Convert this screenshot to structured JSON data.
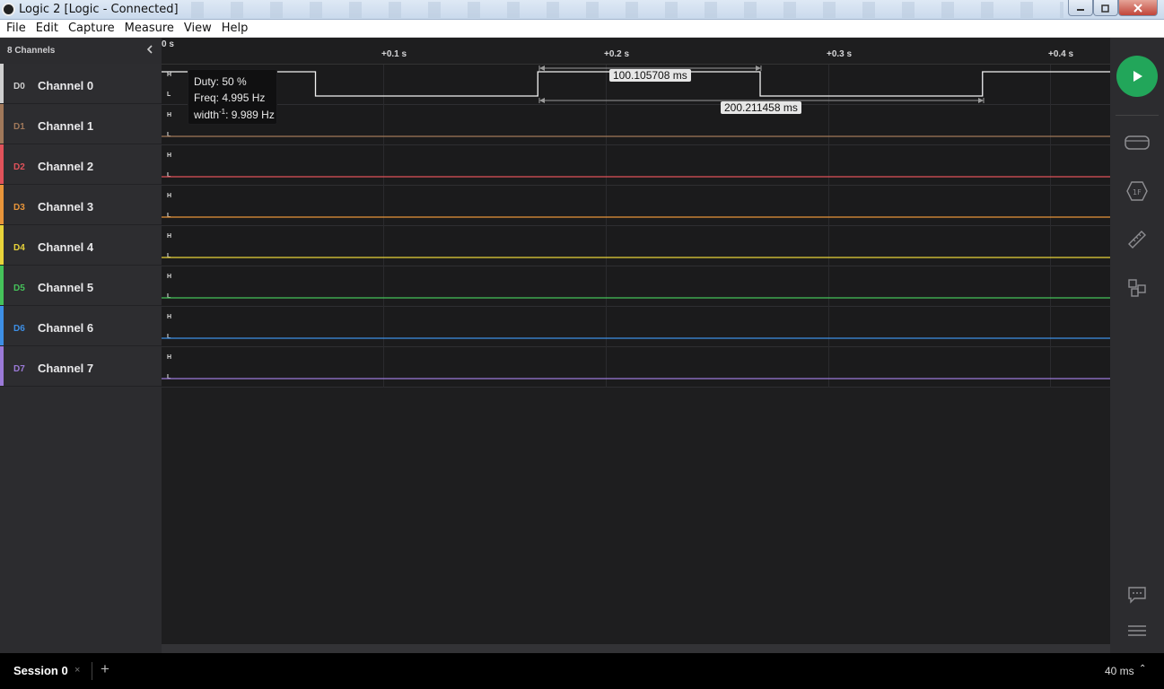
{
  "window": {
    "title": "Logic 2 [Logic - Connected]"
  },
  "menu": [
    "File",
    "Edit",
    "Capture",
    "Measure",
    "View",
    "Help"
  ],
  "sidebar": {
    "header": "8 Channels",
    "channels": [
      {
        "id": "D0",
        "name": "Channel 0",
        "color": "#cfcfcf"
      },
      {
        "id": "D1",
        "name": "Channel 1",
        "color": "#a0785a"
      },
      {
        "id": "D2",
        "name": "Channel 2",
        "color": "#e0525a"
      },
      {
        "id": "D3",
        "name": "Channel 3",
        "color": "#e8953a"
      },
      {
        "id": "D4",
        "name": "Channel 4",
        "color": "#e8d33a"
      },
      {
        "id": "D5",
        "name": "Channel 5",
        "color": "#45c25a"
      },
      {
        "id": "D6",
        "name": "Channel 6",
        "color": "#3d8fe6"
      },
      {
        "id": "D7",
        "name": "Channel 7",
        "color": "#9b7ad8"
      }
    ]
  },
  "ruler": {
    "ticks": [
      "0 s",
      "+0.1 s",
      "+0.2 s",
      "+0.3 s",
      "+0.4 s"
    ]
  },
  "lane_levels": {
    "high": "H",
    "low": "L"
  },
  "tooltip": {
    "duty": "Duty: 50 %",
    "freq": "Freq: 4.995 Hz",
    "width_prefix": "width",
    "width_sup": "-1",
    "width_value": ": 9.989 Hz"
  },
  "measurements": {
    "pulse_width": "100.105708 ms",
    "period": "200.211458 ms"
  },
  "signal": {
    "channel": "D0",
    "unit": "s",
    "transitions_s": [
      0.0693,
      0.1694,
      0.2695,
      0.3696
    ],
    "levels": [
      "H",
      "L",
      "H",
      "L",
      "H"
    ]
  },
  "bottom": {
    "session": "Session 0",
    "close": "×",
    "add": "+",
    "duration": "40 ms",
    "caret": "⌃"
  },
  "colors": {
    "play": "#22a65a",
    "background": "#1e1e1f",
    "sidebar": "#2c2c2f"
  },
  "icons": [
    "play-icon",
    "analyzer-icon",
    "trigger-icon",
    "measure-icon",
    "extensions-icon",
    "feedback-icon",
    "menu-icon"
  ]
}
